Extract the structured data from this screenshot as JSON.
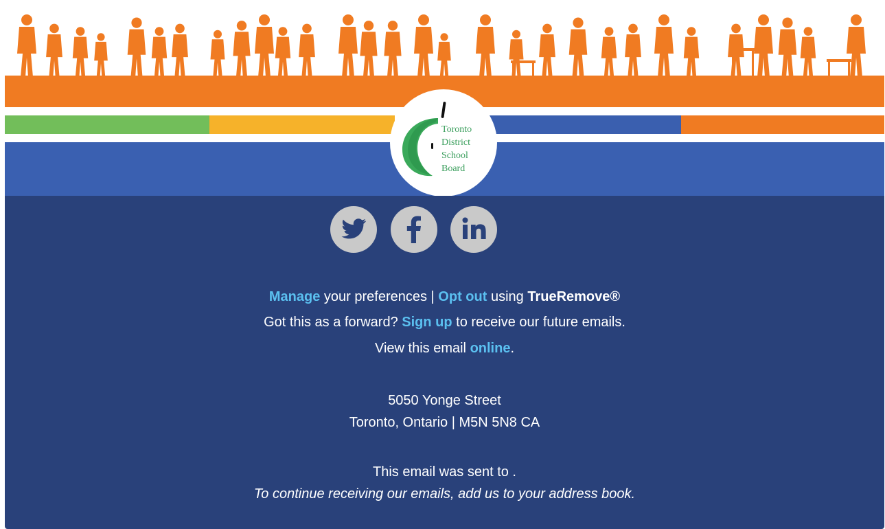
{
  "header": {
    "logo": {
      "line1": "Toronto",
      "line2": "District",
      "line3": "School",
      "line4": "Board",
      "colors": {
        "apple": "#3aa95a",
        "stem": "#111111"
      }
    },
    "colors": {
      "orange": "#f07b22",
      "green": "#72be5a",
      "yellow": "#f6b22a",
      "blue": "#3a60b1"
    }
  },
  "social": {
    "twitter": "twitter-icon",
    "facebook": "facebook-icon",
    "linkedin": "linkedin-icon"
  },
  "footer": {
    "background": "#29417a",
    "link_color": "#5bc0f0",
    "prefs": {
      "manage_link": "Manage",
      "manage_text": " your preferences | ",
      "optout_link": "Opt out",
      "using_text": " using ",
      "trueremove": "TrueRemove®"
    },
    "forward": {
      "text1": "Got this as a forward? ",
      "signup_link": "Sign up",
      "text2": " to receive our future emails."
    },
    "online": {
      "text1": "View this email ",
      "online_link": "online",
      "text2": "."
    },
    "address": {
      "line1": "5050 Yonge Street",
      "line2": "Toronto, Ontario | M5N 5N8 CA"
    },
    "sent_to": "This email was sent to .",
    "address_book": "To continue receiving our emails, add us to your address book."
  }
}
